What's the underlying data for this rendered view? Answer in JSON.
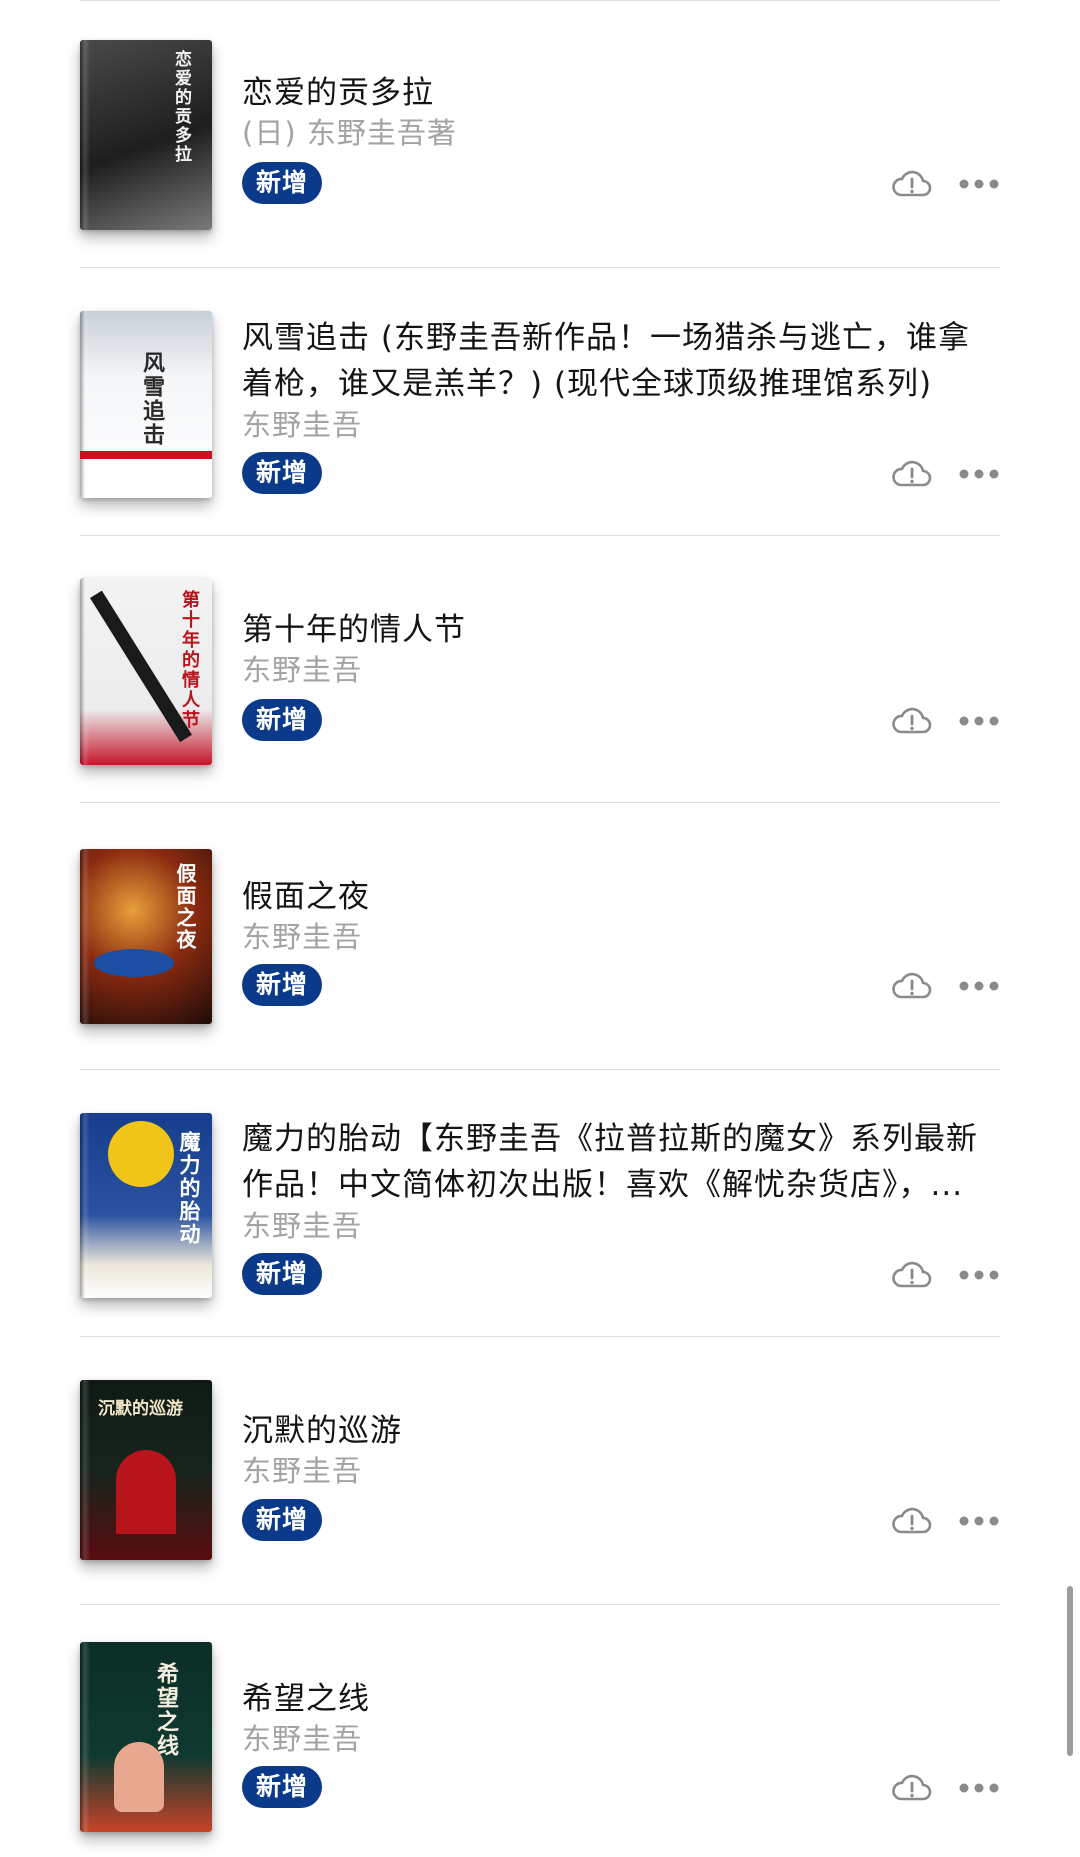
{
  "books": [
    {
      "title": "恋爱的贡多拉",
      "author": "(日) 东野圭吾著",
      "badge": "新增",
      "cover_text": "恋爱的贡多拉",
      "cover_colors": [
        "#2e2e2e",
        "#6e6e6e"
      ],
      "icon": "cloud-alert-icon"
    },
    {
      "title": "风雪追击 (东野圭吾新作品！一场猎杀与逃亡，谁拿着枪，谁又是羔羊？) (现代全球顶级推理馆系列)",
      "author": "东野圭吾",
      "badge": "新增",
      "cover_text": "风雪追击",
      "cover_colors": [
        "#dfe5ea",
        "#ffffff"
      ],
      "icon": "cloud-alert-icon"
    },
    {
      "title": "第十年的情人节",
      "author": "东野圭吾",
      "badge": "新增",
      "cover_text": "第十年的情人节",
      "cover_colors": [
        "#f2f2f2",
        "#c4162b"
      ],
      "icon": "cloud-alert-icon"
    },
    {
      "title": "假面之夜",
      "author": "东野圭吾",
      "badge": "新增",
      "cover_text": "假面之夜",
      "cover_colors": [
        "#3a1208",
        "#b33a12"
      ],
      "icon": "cloud-alert-icon"
    },
    {
      "title": "魔力的胎动【东野圭吾《拉普拉斯的魔女》系列最新作品！中文简体初次出版！喜欢《解忧杂货店》，...",
      "author": "东野圭吾",
      "badge": "新增",
      "cover_text": "魔力的胎动",
      "cover_colors": [
        "#123a86",
        "#e9e4d8"
      ],
      "icon": "cloud-alert-icon"
    },
    {
      "title": "沉默的巡游",
      "author": "东野圭吾",
      "badge": "新增",
      "cover_text": "沉默的巡游",
      "cover_colors": [
        "#0f1a14",
        "#b8141c"
      ],
      "icon": "cloud-alert-icon"
    },
    {
      "title": "希望之线",
      "author": "东野圭吾",
      "badge": "新增",
      "cover_text": "希望之线",
      "cover_colors": [
        "#0b2e26",
        "#d8492c"
      ],
      "icon": "cloud-alert-icon"
    }
  ],
  "colors": {
    "badge_bg": "#0c3a8a",
    "title": "#141414",
    "author": "#a3a3a3",
    "icon_gray": "#8a8a8a"
  }
}
